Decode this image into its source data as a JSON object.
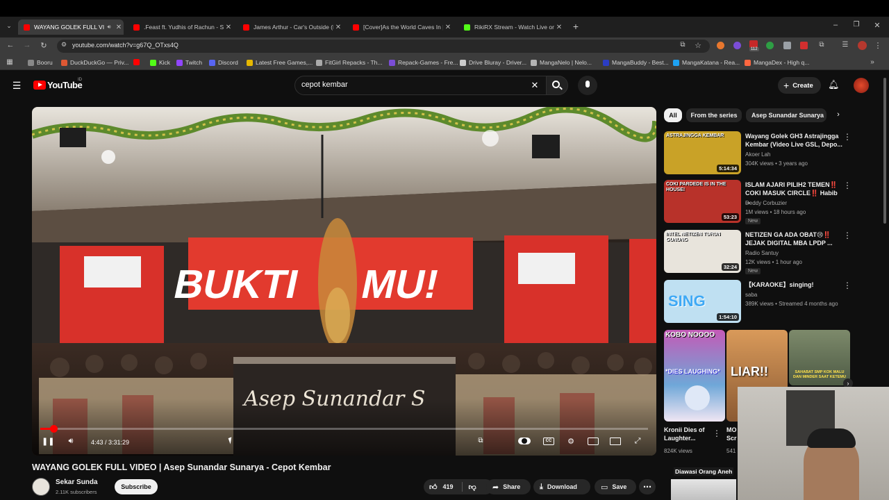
{
  "browser": {
    "tabs": [
      {
        "title": "WAYANG GOLEK FULL VIDE",
        "active": true,
        "favicon_color": "#ff0000"
      },
      {
        "title": ".Feast ft. Yudhis of Rachun - Se",
        "active": false,
        "favicon_color": "#ff0000"
      },
      {
        "title": "James Arthur - Car's Outside (L",
        "active": false,
        "favicon_color": "#ff0000"
      },
      {
        "title": "[Cover]As the World Caves In |",
        "active": false,
        "favicon_color": "#ff0000"
      },
      {
        "title": "RikiRX Stream - Watch Live on",
        "active": false,
        "favicon_color": "#53fc18"
      }
    ],
    "url": "youtube.com/watch?v=g67Q_OTxs4Q",
    "extension_badge": "112",
    "bookmarks": [
      {
        "label": "Booru",
        "color": "#888"
      },
      {
        "label": "DuckDuckGo — Priv...",
        "color": "#de5833"
      },
      {
        "label": "",
        "color": "#ff0000"
      },
      {
        "label": "Kick",
        "color": "#53fc18"
      },
      {
        "label": "Twitch",
        "color": "#9146ff"
      },
      {
        "label": "Discord",
        "color": "#5865f2"
      },
      {
        "label": "Latest Free Games,...",
        "color": "#e6b800"
      },
      {
        "label": "FitGirl Repacks - Th...",
        "color": "#aaaaaa"
      },
      {
        "label": "Repack-Games - Fre...",
        "color": "#7b4dd6"
      },
      {
        "label": "Drive Bluray - Driver...",
        "color": "#cccccc"
      },
      {
        "label": "MangaNelo | Nelo...",
        "color": "#b5b5b5"
      },
      {
        "label": "MangaBuddy - Best...",
        "color": "#2b3dc4"
      },
      {
        "label": "MangaKatana - Rea...",
        "color": "#1da1f2"
      },
      {
        "label": "MangaDex - High q...",
        "color": "#ff6740"
      }
    ]
  },
  "youtube": {
    "logo": "YouTube",
    "country": "ID",
    "search_value": "cepot kembar",
    "create_label": "Create"
  },
  "video": {
    "time_current": "4:43",
    "time_total": "3:31:29",
    "time_display": "4:43 / 3:31:29",
    "progress": 0.022,
    "title": "WAYANG GOLEK FULL VIDEO | Asep Sunandar Sunarya - Cepot Kembar",
    "channel": "Sekar Sunda",
    "subscribers": "2.11K subscribers",
    "subscribe_label": "Subscribe",
    "likes": "419",
    "share_label": "Share",
    "download_label": "Download",
    "save_label": "Save",
    "stage_banner": "BUKTI",
    "stage_banner_2": "MU!",
    "stage_sign": "Asep Sunandar S"
  },
  "sidebar": {
    "chips": [
      "All",
      "From the series",
      "Asep Sunandar Sunarya"
    ],
    "recommendations": [
      {
        "title": "Wayang Golek GH3 Astrajingga Kembar (Video Live GSL, Depo...",
        "channel": "Akoer Lah",
        "meta": "304K views • 3 years ago",
        "duration": "5:14:34",
        "new": "",
        "thumb_text": "ASTRAJINGGA KEMBAR",
        "thumb_color": "#c9a227"
      },
      {
        "title": "ISLAM AJARI PILIH2 TEMEN‼️ COKI MASUK CIRCLE‼️ Habib ...",
        "channel": "Deddy Corbuzier",
        "meta": "1M views • 18 hours ago",
        "duration": "53:23",
        "new": "New",
        "thumb_text": "COKI PARDEDE IS IN THE HOUSE!",
        "thumb_color": "#b8322a"
      },
      {
        "title": "NETIZEN GA ADA OBAT😢‼️ JEJAK DIGITAL MBA LPDP ...",
        "channel": "Radio Santuy",
        "meta": "12K views • 1 hour ago",
        "duration": "32:24",
        "new": "New",
        "thumb_text": "INTEL NETIZEN TURUN GUNUNG",
        "thumb_color": "#e8e4dc"
      },
      {
        "title": "【KARAOKE】singing!",
        "channel": "saba",
        "meta": "389K views • Streamed 4 months ago",
        "duration": "1:54:10",
        "new": "",
        "thumb_text": "SING",
        "thumb_color": "#bfe0f2"
      }
    ],
    "shorts": [
      {
        "title": "Kronii Dies of Laughter...",
        "views": "824K views",
        "thumb_text": "*DIES LAUGHING*",
        "top_text": "KOBO NOOOO"
      },
      {
        "title": "MO Scr",
        "views": "541",
        "thumb_text": "LIAR!!",
        "top_text": ""
      },
      {
        "title": "",
        "views": "",
        "thumb_text": "SAHABAT SMP KOK MALU DAN MINDER SAAT KETEMU",
        "top_text": ""
      }
    ],
    "webcam_label": "Diawasi Orang Aneh"
  },
  "colors": {
    "yt_red": "#ff0000",
    "background": "#0f0f0f",
    "chip_bg": "#272727"
  }
}
